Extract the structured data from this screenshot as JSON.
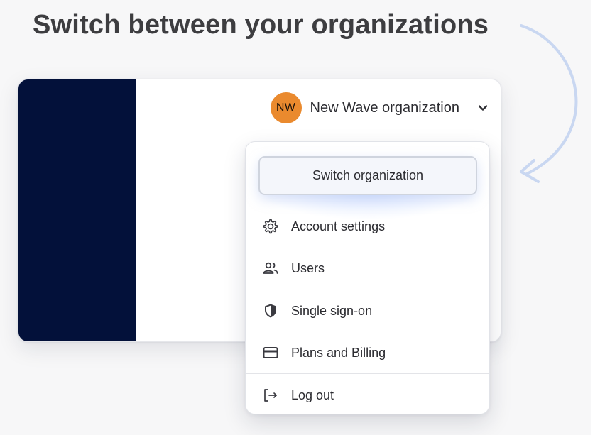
{
  "headline": "Switch between your organizations",
  "org_switcher": {
    "avatar_initials": "NW",
    "org_name": "New Wave organization",
    "avatar_color": "#ea8a2e"
  },
  "menu": {
    "switch_label": "Switch organization",
    "items": [
      {
        "label": "Account settings",
        "icon": "gear-icon"
      },
      {
        "label": "Users",
        "icon": "users-icon"
      },
      {
        "label": "Single sign-on",
        "icon": "shield-icon"
      },
      {
        "label": "Plans and Billing",
        "icon": "credit-card-icon"
      },
      {
        "label": "Log out",
        "icon": "logout-icon"
      }
    ]
  },
  "colors": {
    "sidebar": "#03113a",
    "arrow": "#c9d7f1",
    "text": "#2b2b30"
  }
}
